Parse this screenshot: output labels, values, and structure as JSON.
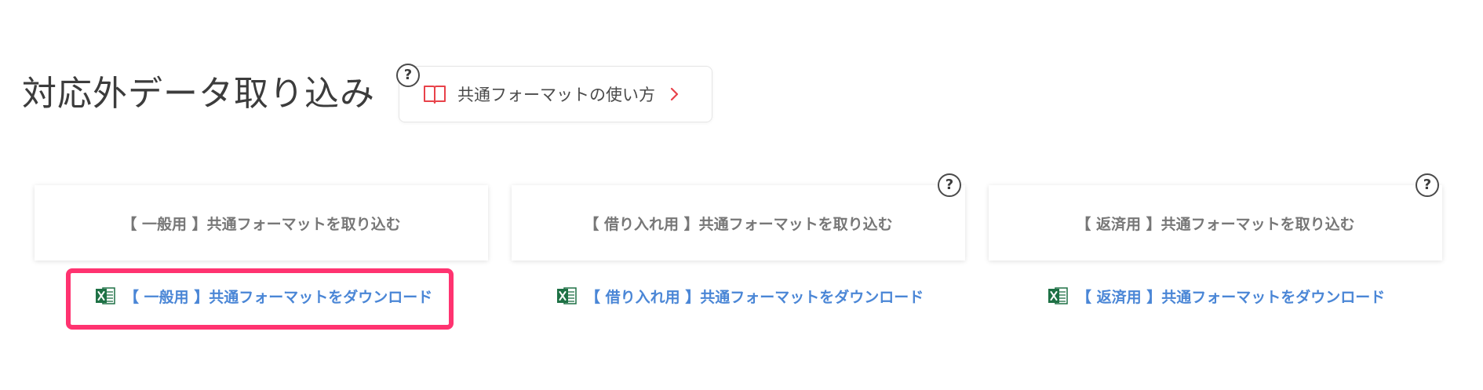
{
  "page": {
    "title": "対応外データ取り込み"
  },
  "guide": {
    "label": "共通フォーマットの使い方",
    "help_symbol": "?",
    "icon": "book-icon",
    "chevron_icon": "chevron-right-icon",
    "chevron_color": "#e8424a",
    "icon_color": "#e8424a"
  },
  "import_cards": [
    {
      "label": "【 一般用 】共通フォーマットを取り込む"
    },
    {
      "label": "【 借り入れ用 】共通フォーマットを取り込む",
      "help_symbol": "?"
    },
    {
      "label": "【 返済用 】共通フォーマットを取り込む",
      "help_symbol": "?"
    }
  ],
  "download_links": [
    {
      "label": "【 一般用 】共通フォーマットをダウンロード",
      "icon": "excel-icon"
    },
    {
      "label": "【 借り入れ用 】共通フォーマットをダウンロード",
      "icon": "excel-icon"
    },
    {
      "label": "【 返済用 】共通フォーマットをダウンロード",
      "icon": "excel-icon"
    }
  ],
  "colors": {
    "link": "#4a86d6",
    "highlight": "#ff3370",
    "excel_green": "#1e7145"
  }
}
